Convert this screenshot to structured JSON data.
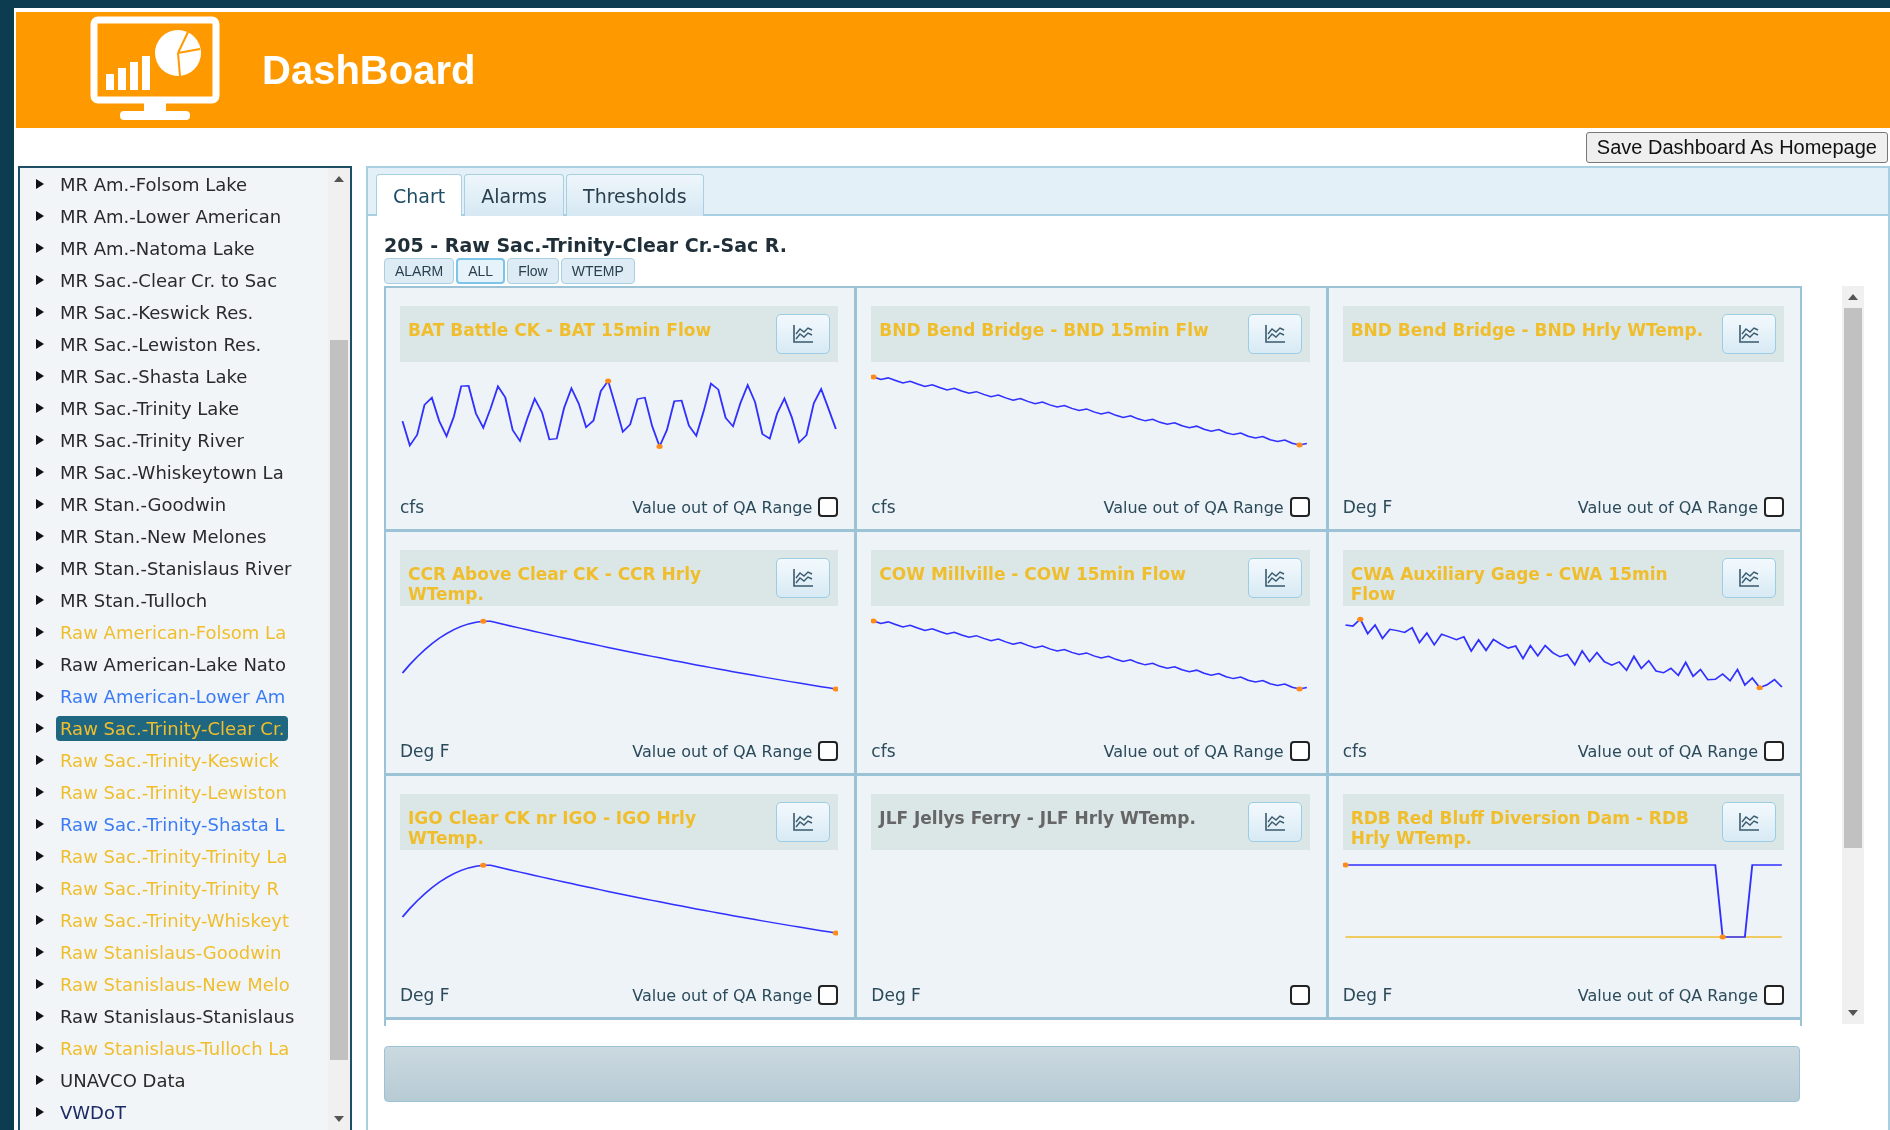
{
  "header": {
    "title": "DashBoard"
  },
  "save_button": "Save Dashboard As Homepage",
  "sidebar": {
    "items": [
      {
        "label": "MR Am.-Folsom Lake",
        "color": "#2a2a2a",
        "selected": false
      },
      {
        "label": "MR Am.-Lower American",
        "color": "#2a2a2a",
        "selected": false
      },
      {
        "label": "MR Am.-Natoma Lake",
        "color": "#2a2a2a",
        "selected": false
      },
      {
        "label": "MR Sac.-Clear Cr. to Sac",
        "color": "#2a2a2a",
        "selected": false
      },
      {
        "label": "MR Sac.-Keswick Res.",
        "color": "#2a2a2a",
        "selected": false
      },
      {
        "label": "MR Sac.-Lewiston Res.",
        "color": "#2a2a2a",
        "selected": false
      },
      {
        "label": "MR Sac.-Shasta Lake",
        "color": "#2a2a2a",
        "selected": false
      },
      {
        "label": "MR Sac.-Trinity Lake",
        "color": "#2a2a2a",
        "selected": false
      },
      {
        "label": "MR Sac.-Trinity River",
        "color": "#2a2a2a",
        "selected": false
      },
      {
        "label": "MR Sac.-Whiskeytown La",
        "color": "#2a2a2a",
        "selected": false
      },
      {
        "label": "MR Stan.-Goodwin",
        "color": "#2a2a2a",
        "selected": false
      },
      {
        "label": "MR Stan.-New Melones",
        "color": "#2a2a2a",
        "selected": false
      },
      {
        "label": "MR Stan.-Stanislaus River",
        "color": "#2a2a2a",
        "selected": false
      },
      {
        "label": "MR Stan.-Tulloch",
        "color": "#2a2a2a",
        "selected": false
      },
      {
        "label": "Raw American-Folsom La",
        "color": "#f0be2c",
        "selected": false
      },
      {
        "label": "Raw American-Lake Nato",
        "color": "#2a2a2a",
        "selected": false
      },
      {
        "label": "Raw American-Lower Am",
        "color": "#3b7cf4",
        "selected": false
      },
      {
        "label": "Raw Sac.-Trinity-Clear Cr.",
        "color": "#f0be2c",
        "selected": true
      },
      {
        "label": "Raw Sac.-Trinity-Keswick",
        "color": "#f0be2c",
        "selected": false
      },
      {
        "label": "Raw Sac.-Trinity-Lewiston",
        "color": "#f0be2c",
        "selected": false
      },
      {
        "label": "Raw Sac.-Trinity-Shasta L",
        "color": "#3b7cf4",
        "selected": false
      },
      {
        "label": "Raw Sac.-Trinity-Trinity La",
        "color": "#f0be2c",
        "selected": false
      },
      {
        "label": "Raw Sac.-Trinity-Trinity R",
        "color": "#f0be2c",
        "selected": false
      },
      {
        "label": "Raw Sac.-Trinity-Whiskeyt",
        "color": "#f0be2c",
        "selected": false
      },
      {
        "label": "Raw Stanislaus-Goodwin",
        "color": "#f0be2c",
        "selected": false
      },
      {
        "label": "Raw Stanislaus-New Melo",
        "color": "#f0be2c",
        "selected": false
      },
      {
        "label": "Raw Stanislaus-Stanislaus",
        "color": "#2a2a2a",
        "selected": false
      },
      {
        "label": "Raw Stanislaus-Tulloch La",
        "color": "#f0be2c",
        "selected": false
      },
      {
        "label": "UNAVCO Data",
        "color": "#2a2a2a",
        "selected": false
      },
      {
        "label": "VWDoT",
        "color": "#1c2a66",
        "selected": false
      }
    ]
  },
  "tabs": [
    {
      "label": "Chart",
      "selected": true
    },
    {
      "label": "Alarms",
      "selected": false
    },
    {
      "label": "Thresholds",
      "selected": false
    }
  ],
  "panel_title": "205 - Raw Sac.-Trinity-Clear Cr.-Sac R.",
  "filters": [
    {
      "label": "ALARM",
      "selected": false
    },
    {
      "label": "ALL",
      "selected": true
    },
    {
      "label": "Flow",
      "selected": false
    },
    {
      "label": "WTEMP",
      "selected": false
    }
  ],
  "cards": [
    {
      "title": "BAT Battle CK - BAT 15min Flow",
      "color": "#f0be2c",
      "kind": "wavy",
      "unit": "cfs",
      "qa_label": "Value out of QA Range",
      "checked": false
    },
    {
      "title": "BND Bend Bridge - BND 15min Flw",
      "color": "#f0be2c",
      "kind": "falling",
      "unit": "cfs",
      "qa_label": "Value out of QA Range",
      "checked": false
    },
    {
      "title": "BND Bend Bridge - BND Hrly WTemp.",
      "color": "#f0be2c",
      "kind": "empty",
      "unit": "Deg F",
      "qa_label": "Value out of QA Range",
      "checked": false
    },
    {
      "title": "CCR Above Clear CK - CCR Hrly WTemp.",
      "color": "#f0be2c",
      "kind": "hump",
      "unit": "Deg F",
      "qa_label": "Value out of QA Range",
      "checked": false
    },
    {
      "title": "COW Millville - COW 15min Flow",
      "color": "#f0be2c",
      "kind": "falling",
      "unit": "cfs",
      "qa_label": "Value out of QA Range",
      "checked": false
    },
    {
      "title": "CWA Auxiliary Gage - CWA 15min Flow",
      "color": "#f0be2c",
      "kind": "noisy",
      "unit": "cfs",
      "qa_label": "Value out of QA Range",
      "checked": false
    },
    {
      "title": "IGO Clear CK nr IGO - IGO Hrly WTemp.",
      "color": "#f0be2c",
      "kind": "hump",
      "unit": "Deg F",
      "qa_label": "Value out of QA Range",
      "checked": false
    },
    {
      "title": "JLF Jellys Ferry - JLF Hrly WTemp.",
      "color": "#666666",
      "kind": "empty",
      "unit": "Deg F",
      "checked": false
    },
    {
      "title": "RDB Red Bluff Diversion Dam - RDB Hrly WTemp.",
      "color": "#f0be2c",
      "kind": "drop",
      "unit": "Deg F",
      "qa_label": "Value out of QA Range",
      "checked": false
    }
  ]
}
